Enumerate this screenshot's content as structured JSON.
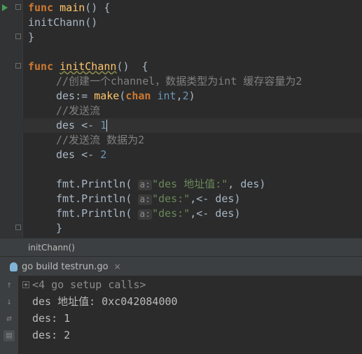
{
  "editor": {
    "line1": {
      "kw": "func",
      "fn": "main",
      "rest": "() {"
    },
    "line2": "initChann()",
    "line3": "}",
    "line5": {
      "kw": "func",
      "fn": "initChann",
      "rest": "()  {"
    },
    "line6": "//创建一个channel，数据类型为int 缓存容量为2",
    "line7": {
      "a": "des:= ",
      "fn": "make",
      "b": "(",
      "kw1": "chan",
      "c": " ",
      "kw2": "int",
      "d": ",",
      "num": "2",
      "e": ")"
    },
    "line8": "//发送流",
    "line9": {
      "a": "des <- ",
      "num": "1"
    },
    "line10": "//发送流 数据为2",
    "line11": {
      "a": "des <- ",
      "num": "2"
    },
    "line13": {
      "a": "fmt.Println( ",
      "hint": "a:",
      "str": "\"des 地址值:\"",
      "b": ", des)"
    },
    "line14": {
      "a": "fmt.Println( ",
      "hint": "a:",
      "str": "\"des:\"",
      "b": ",<- des)"
    },
    "line15": {
      "a": "fmt.Println( ",
      "hint": "a:",
      "str": "\"des:\"",
      "b": ",<- des)"
    },
    "line16": "}"
  },
  "breadcrumb": "initChann()",
  "run_tab": {
    "label": "go build testrun.go",
    "close": "×"
  },
  "console": {
    "collapsed": "<4 go setup calls>",
    "plus": "+",
    "lines": [
      "des 地址值: 0xc042084000",
      "des: 1",
      "des: 2"
    ]
  },
  "toolstrip": {
    "icons": [
      "arrow-up-icon",
      "arrow-down-icon",
      "wrap-icon",
      "print-icon"
    ],
    "glyphs": [
      "↑",
      "↓",
      "⇄",
      "▤"
    ]
  }
}
